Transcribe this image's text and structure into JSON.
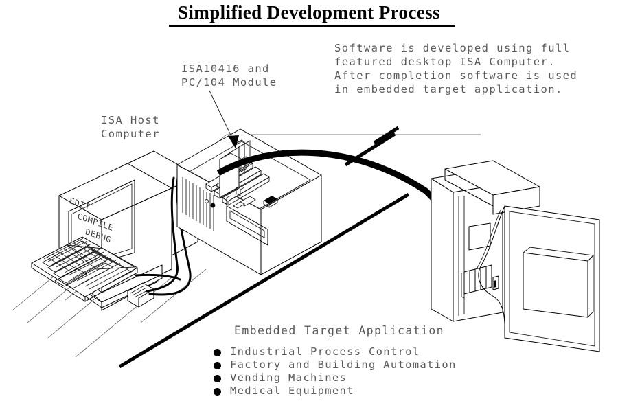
{
  "title": {
    "text": "Simplified Development Process"
  },
  "description": {
    "lines": [
      "Software is developed using full",
      "featured desktop ISA Computer.",
      "After completion software is used",
      "in embedded target application."
    ]
  },
  "labels": {
    "module": "ISA10416 and\nPC/104 Module",
    "module_line1": "ISA10416 and",
    "module_line2": "PC/104 Module",
    "host_computer": "ISA Host\nComputer",
    "host_line1": "ISA Host",
    "host_line2": "Computer",
    "embedded_heading": "Embedded Target Application"
  },
  "screen": {
    "lines": [
      "EDIT",
      "COMPILE",
      "DEBUG"
    ],
    "text": "EDIT\n COMPILE\n   DEBUG"
  },
  "applications": [
    "Industrial Process Control",
    "Factory and Building Automation",
    "Vending Machines",
    "Medical Equipment"
  ],
  "colors": {
    "background": "#ffffff",
    "line": "#000000",
    "tech_text": "#5a5a5a",
    "title_text": "#000000",
    "bullet": "#000000"
  },
  "diagram": {
    "type": "technical-illustration",
    "elements": [
      "isa-host-computer",
      "crt-monitor",
      "keyboard",
      "mouse",
      "desktop-chassis",
      "pc104-module-card",
      "isa-slots",
      "embedded-target-enclosure",
      "workflow-arrow",
      "desk-surface"
    ]
  }
}
